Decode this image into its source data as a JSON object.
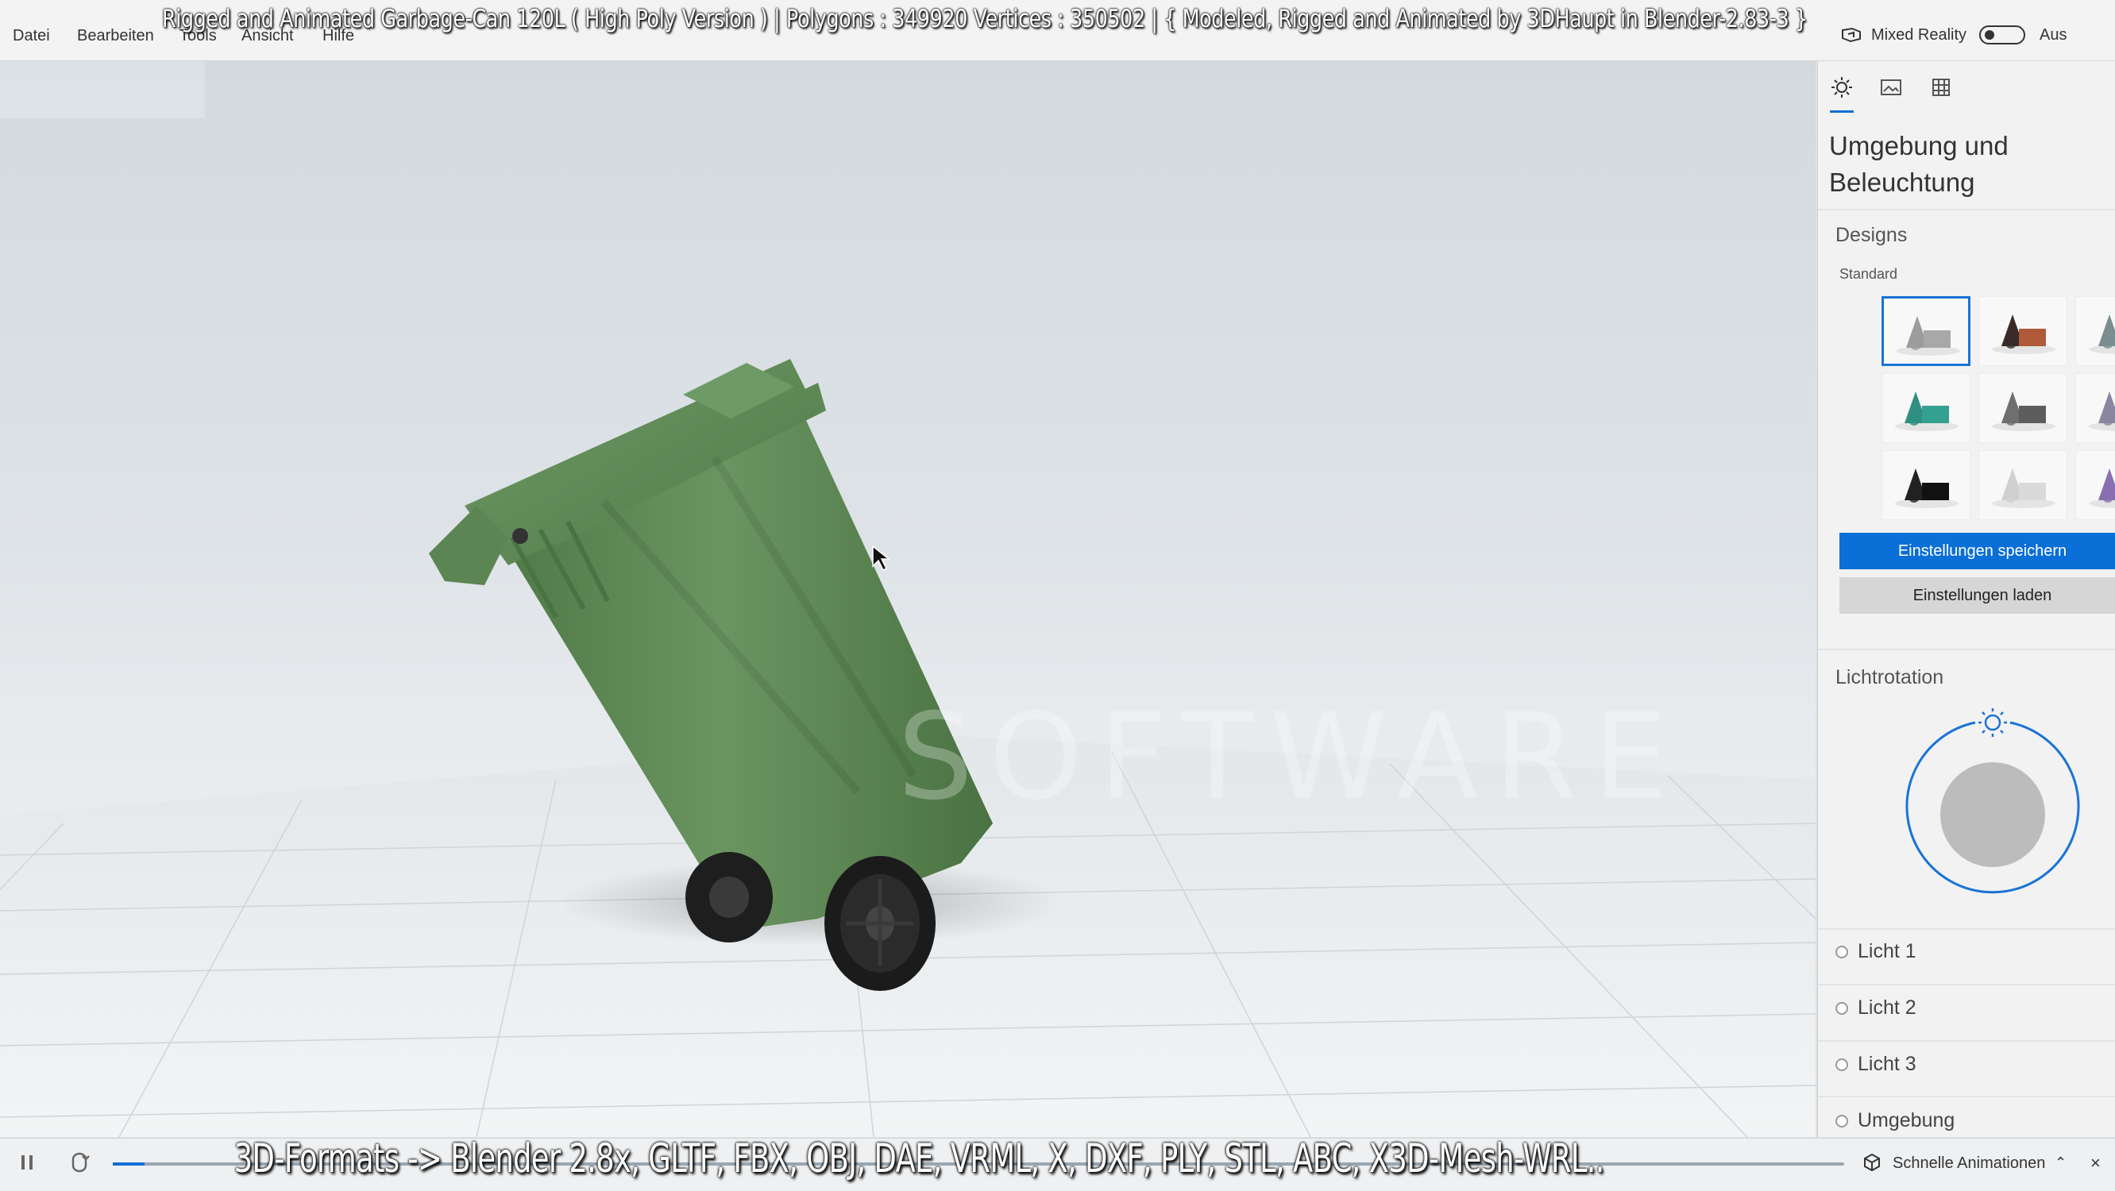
{
  "menu": {
    "items": [
      "Datei",
      "Bearbeiten",
      "Tools",
      "Ansicht",
      "Hilfe"
    ]
  },
  "overlay_title": "Rigged and Animated Garbage-Can 120L ( High Poly Version ) |  Polygons : 349920  Vertices : 350502   |   { Modeled, Rigged and Animated by 3DHaupt in Blender-2.83-3 }",
  "mixed_reality": {
    "label": "Mixed Reality",
    "state": "Aus",
    "icon": "mixed-reality-icon"
  },
  "viewport": {
    "watermark": "SOFTWARE",
    "model_color": "#5b8552"
  },
  "panel": {
    "tabs": [
      {
        "icon": "sun-icon",
        "active": true
      },
      {
        "icon": "background-image-icon",
        "active": false
      },
      {
        "icon": "grid-icon",
        "active": false
      }
    ],
    "title": "Umgebung und Beleuchtung",
    "designs": {
      "title": "Designs",
      "sublabel": "Standard",
      "thumbs": [
        {
          "name": "grey",
          "cone": "#9c9c9c",
          "box": "#a8a8a8",
          "selected": true
        },
        {
          "name": "dark-red",
          "cone": "#3a2a2a",
          "box": "#b05a3a",
          "selected": false
        },
        {
          "name": "teal-grey",
          "cone": "#7a8e90",
          "box": "#5d9c9a",
          "selected": false
        },
        {
          "name": "teal",
          "cone": "#2f8f80",
          "box": "#34a08f",
          "selected": false
        },
        {
          "name": "charcoal",
          "cone": "#6f6f6f",
          "box": "#5d5d5d",
          "selected": false
        },
        {
          "name": "violet",
          "cone": "#8a86a0",
          "box": "#6e6e82",
          "selected": false
        },
        {
          "name": "black",
          "cone": "#222222",
          "box": "#111111",
          "selected": false
        },
        {
          "name": "light",
          "cone": "#d0d0d0",
          "box": "#dadada",
          "selected": false
        },
        {
          "name": "sunset",
          "cone": "#8a6fb0",
          "box": "#d08a5a",
          "selected": false
        }
      ]
    },
    "save_button": "Einstellungen speichern",
    "load_button": "Einstellungen laden",
    "light_rotation": {
      "title": "Lichtrotation",
      "icon": "sun-icon"
    },
    "lights": [
      "Licht 1",
      "Licht 2",
      "Licht 3",
      "Umgebung"
    ]
  },
  "bottom": {
    "caption": "3D-Formats -> Blender 2.8x, GLTF, FBX, OBJ, DAE, VRML, X, DXF, PLY, STL, ABC, X3D-Mesh-WRL..",
    "animation_label": "Schnelle Animationen",
    "controls": [
      "pause-icon",
      "loop-icon"
    ]
  },
  "colors": {
    "accent": "#0a6fd6",
    "panel_bg": "#f2f2f2"
  }
}
